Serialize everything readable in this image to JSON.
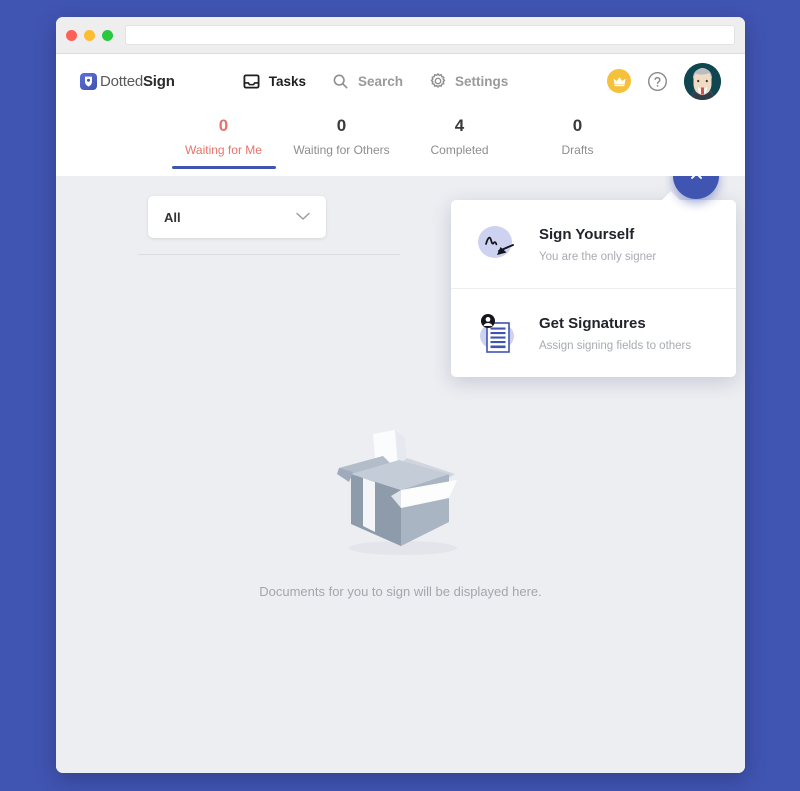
{
  "window": {
    "url_bar_value": "",
    "url_bar_placeholder": ""
  },
  "header": {
    "brand_prefix": "Dotted",
    "brand_suffix": "Sign",
    "nav": [
      {
        "label": "Tasks",
        "icon": "inbox-icon",
        "active": true
      },
      {
        "label": "Search",
        "icon": "search-icon",
        "active": false
      },
      {
        "label": "Settings",
        "icon": "gear-icon",
        "active": false
      }
    ],
    "crown_icon": "crown-icon",
    "help_icon": "help-circle-icon",
    "avatar_icon": "user-avatar"
  },
  "tabs": [
    {
      "count": "0",
      "label": "Waiting for Me",
      "active": true
    },
    {
      "count": "0",
      "label": "Waiting for Others",
      "active": false
    },
    {
      "count": "4",
      "label": "Completed",
      "active": false
    },
    {
      "count": "0",
      "label": "Drafts",
      "active": false
    }
  ],
  "filter": {
    "value": "All",
    "chevron_icon": "chevron-down-icon"
  },
  "fab": {
    "icon": "close-icon",
    "label": "Close create menu"
  },
  "popup": {
    "items": [
      {
        "title": "Sign Yourself",
        "subtitle": "You are the only signer",
        "icon": "signature-icon"
      },
      {
        "title": "Get Signatures",
        "subtitle": "Assign signing fields to others",
        "icon": "document-signers-icon"
      }
    ]
  },
  "empty_state": {
    "message": "Documents for you to sign will be displayed here.",
    "illustration": "open-empty-box-illustration"
  },
  "colors": {
    "page_background": "#4054B2",
    "accent": "#4054B2",
    "active_tab_text": "#e8736a",
    "content_background": "#edeef2",
    "crown_badge": "#f5c13c"
  }
}
